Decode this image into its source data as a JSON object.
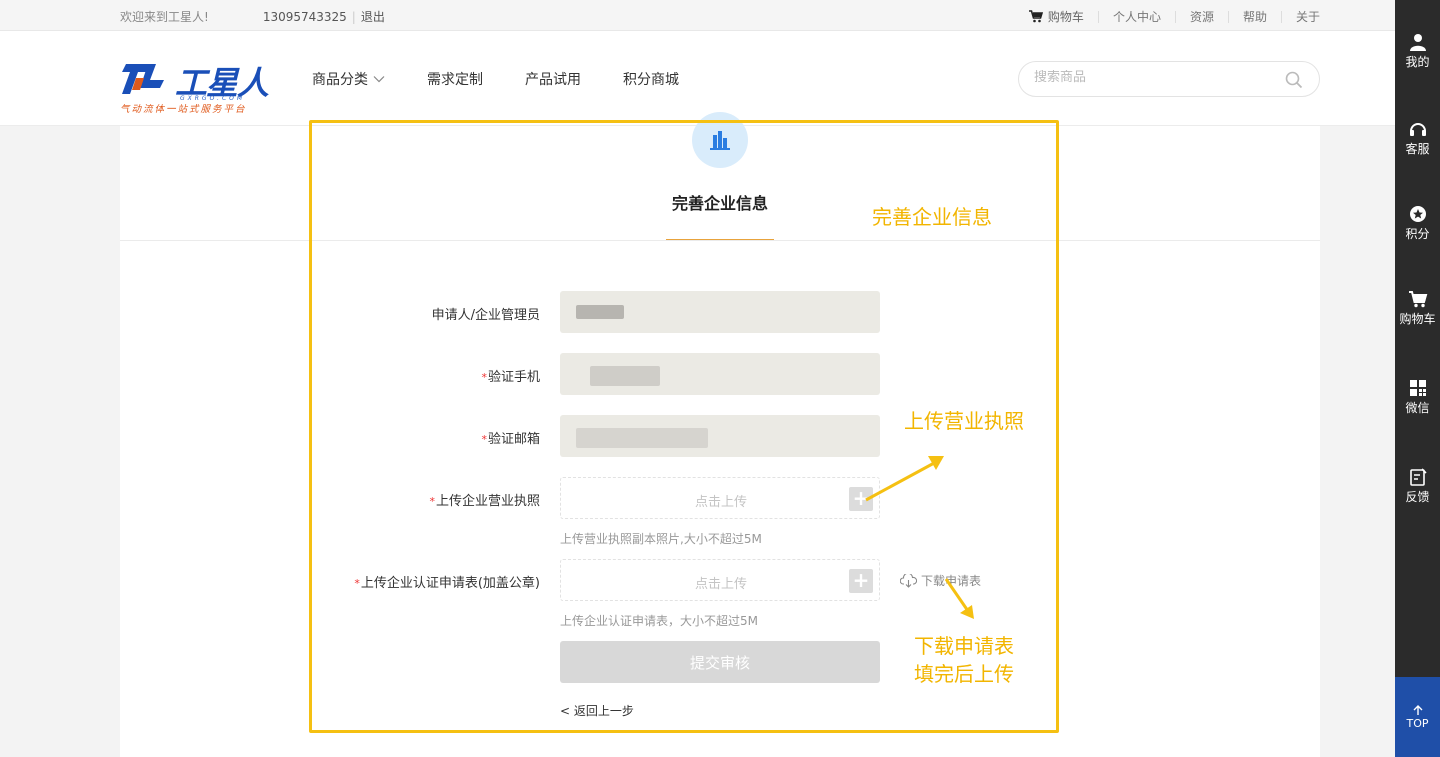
{
  "topbar": {
    "welcome": "欢迎来到工星人!",
    "phone": "13095743325",
    "sep": "|",
    "logout": "退出",
    "cart": "购物车",
    "links": [
      "个人中心",
      "资源",
      "帮助",
      "关于"
    ]
  },
  "header": {
    "logo_brand": "工星人",
    "logo_url": "GXRGO.COM",
    "logo_tagline": "气动流体一站式服务平台",
    "nav": [
      "商品分类",
      "需求定制",
      "产品试用",
      "积分商城"
    ],
    "search_placeholder": "搜索商品"
  },
  "step": {
    "title": "完善企业信息"
  },
  "form": {
    "applicant_label": "申请人/企业管理员",
    "phone_label": "验证手机",
    "email_label": "验证邮箱",
    "license_label": "上传企业营业执照",
    "license_upload_text": "点击上传",
    "license_hint": "上传营业执照副本照片,大小不超过5M",
    "cert_label": "上传企业认证申请表(加盖公章)",
    "cert_upload_text": "点击上传",
    "cert_hint": "上传企业认证申请表，大小不超过5M",
    "download_link": "下载申请表",
    "submit": "提交审核",
    "back": "< 返回上一步",
    "required_mark": "*"
  },
  "annotations": {
    "title_note": "完善企业信息",
    "license_note": "上传营业执照",
    "download_note_1": "下载申请表",
    "download_note_2": "填完后上传"
  },
  "sidebar": {
    "items": [
      "我的",
      "客服",
      "积分",
      "购物车",
      "微信",
      "反馈"
    ],
    "top": "TOP"
  },
  "colors": {
    "brand_blue": "#1a4fb8",
    "annotation_yellow": "#f5c012",
    "step_underline": "#e8a33c",
    "sidebar_bg": "#2b2b2b",
    "top_button": "#1f4fa8"
  }
}
